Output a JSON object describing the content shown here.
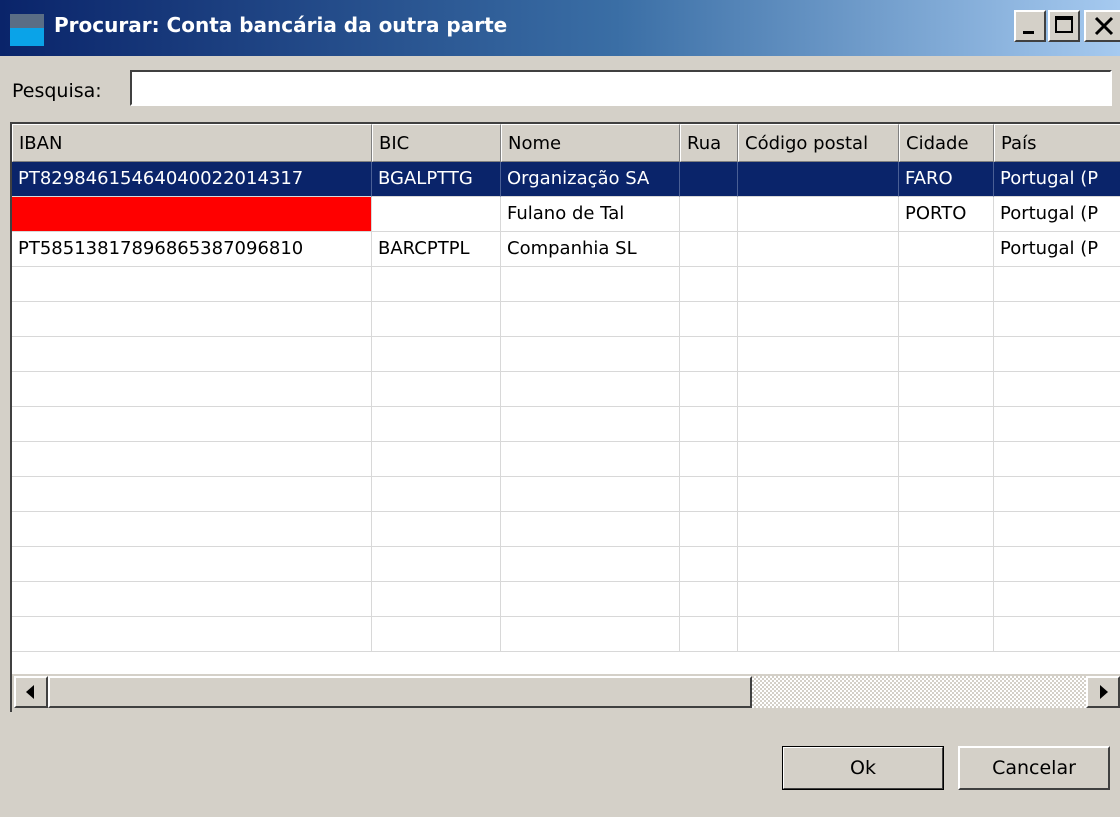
{
  "window": {
    "title": "Procurar: Conta bancária da outra parte"
  },
  "search": {
    "label": "Pesquisa:",
    "value": "",
    "placeholder": ""
  },
  "table": {
    "columns": [
      "IBAN",
      "BIC",
      "Nome",
      "Rua",
      "Código postal",
      "Cidade",
      "País"
    ],
    "rows": [
      {
        "iban": "PT82984615464040022014317",
        "bic": "BGALPTTG",
        "nome": "Organização SA",
        "rua": "",
        "codigo_postal": "",
        "cidade": "FARO",
        "pais": "Portugal (P",
        "selected": true
      },
      {
        "iban": "",
        "bic": "",
        "nome": "Fulano de Tal",
        "rua": "",
        "codigo_postal": "",
        "cidade": "PORTO",
        "pais": "Portugal (P",
        "iban_highlight": "#ff0000"
      },
      {
        "iban": "PT58513817896865387096810",
        "bic": "BARCPTPL",
        "nome": "Companhia SL",
        "rua": "",
        "codigo_postal": "",
        "cidade": "",
        "pais": "Portugal (P"
      }
    ],
    "empty_rows": 11
  },
  "buttons": {
    "ok": "Ok",
    "cancel": "Cancelar"
  },
  "colors": {
    "selection": "#0a246a",
    "error_highlight": "#ff0000",
    "window_bg": "#d4d0c8"
  },
  "icons": {
    "app": "app-window-icon",
    "minimize": "minimize-icon",
    "maximize": "maximize-icon",
    "close": "close-icon",
    "scroll_left": "arrow-left-icon",
    "scroll_right": "arrow-right-icon"
  }
}
